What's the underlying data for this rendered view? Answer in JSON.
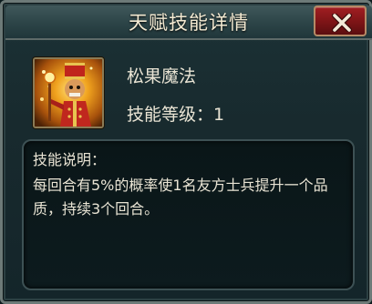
{
  "dialog": {
    "title": "天赋技能详情",
    "close_icon": "close-x-icon"
  },
  "skill": {
    "icon": "nutcracker-mage-portrait",
    "name": "松果魔法",
    "level_label": "技能等级：",
    "level_value": "1"
  },
  "description": {
    "heading": "技能说明：",
    "text": "每回合有5%的概率使1名友方士兵提升一个品质，持续3个回合。"
  },
  "colors": {
    "text": "#e9e4d4",
    "close_button": "#8c1619",
    "panel_border": "#3d5154"
  }
}
